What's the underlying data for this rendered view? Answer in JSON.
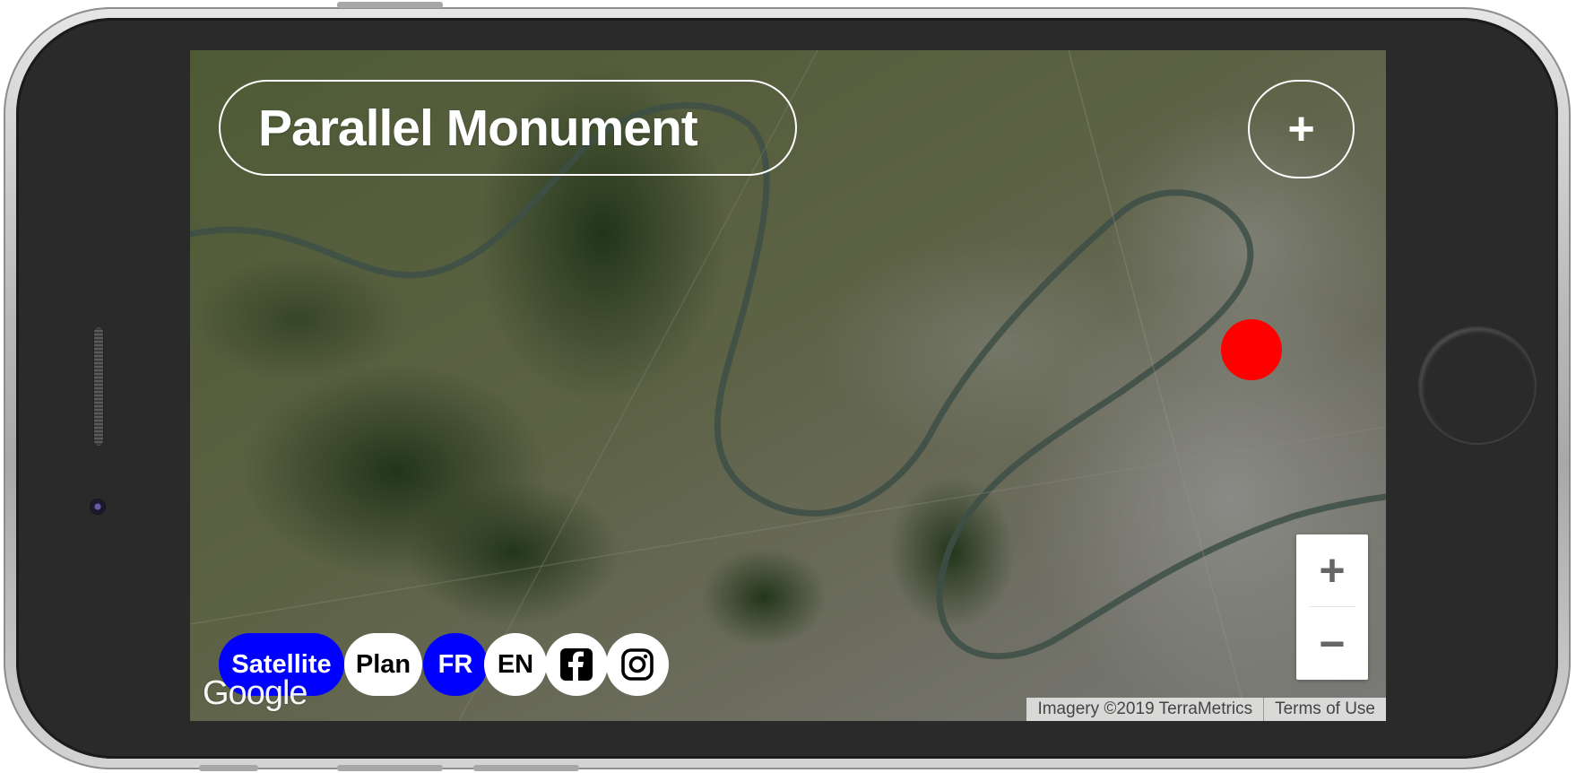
{
  "app": {
    "title": "Parallel Monument",
    "add_button": "+"
  },
  "map": {
    "map_type_buttons": [
      {
        "label": "Satellite",
        "active": true
      },
      {
        "label": "Plan",
        "active": false
      }
    ],
    "language_buttons": [
      {
        "label": "FR",
        "active": true
      },
      {
        "label": "EN",
        "active": false
      }
    ],
    "social": [
      {
        "icon": "facebook-icon"
      },
      {
        "icon": "instagram-icon"
      }
    ],
    "zoom": {
      "in_label": "+",
      "out_label": "−"
    },
    "attribution": "Imagery ©2019 TerraMetrics",
    "terms": "Terms of Use",
    "provider_logo": "Google",
    "marker_color": "#ff0000"
  },
  "colors": {
    "active_chip": "#0000ff",
    "inactive_chip": "#ffffff",
    "marker": "#ff0000"
  }
}
